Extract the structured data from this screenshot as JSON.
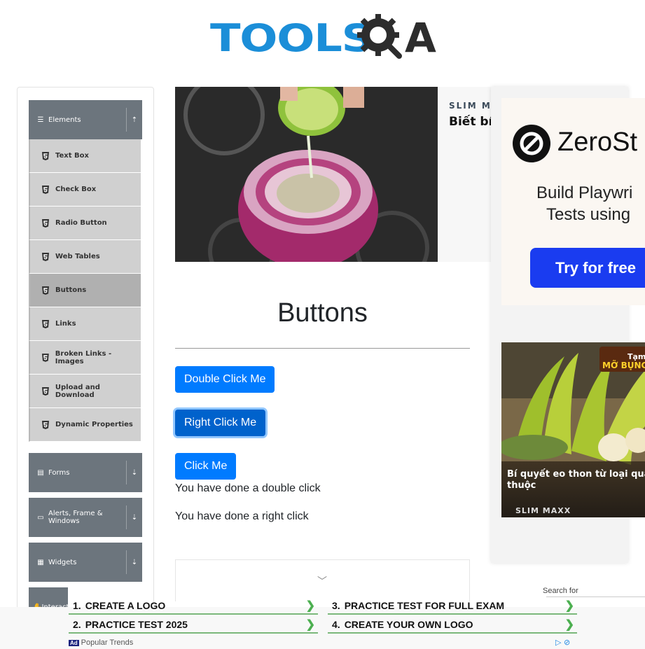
{
  "header": {
    "logo_text": "TOOLS",
    "logo_suffix": "A"
  },
  "sidebar": {
    "groups": [
      {
        "label": "Elements",
        "icon": "hamburger-icon",
        "expanded": true
      },
      {
        "label": "Forms",
        "icon": "document-icon",
        "expanded": false
      },
      {
        "label": "Alerts, Frame & Windows",
        "icon": "window-icon",
        "expanded": false
      },
      {
        "label": "Widgets",
        "icon": "grid-icon",
        "expanded": false
      },
      {
        "label": "Interact",
        "icon": "hand-icon",
        "expanded": false
      }
    ],
    "items": [
      {
        "label": "Text Box"
      },
      {
        "label": "Check Box"
      },
      {
        "label": "Radio Button"
      },
      {
        "label": "Web Tables"
      },
      {
        "label": "Buttons",
        "active": true
      },
      {
        "label": "Links"
      },
      {
        "label": "Broken Links - Images"
      },
      {
        "label": "Upload and Download"
      },
      {
        "label": "Dynamic Properties"
      }
    ]
  },
  "ad_top": {
    "brand": "SLIM MA",
    "headline": "Biết bí"
  },
  "main": {
    "title": "Buttons",
    "buttons": {
      "double": "Double Click Me",
      "right": "Right Click Me",
      "click": "Click Me"
    },
    "messages": {
      "double": "You have done a double click",
      "right": "You have done a right click"
    }
  },
  "ad_right": {
    "zero_name": "ZeroSt",
    "line1": "Build Playwri",
    "line2": "Tests using",
    "cta": "Try for free",
    "banana_tag1": "Tạm",
    "banana_tag2": "MỠ BỤNG,",
    "banana_caption": "Bí quyết eo thon từ loại quả q thuộc",
    "banana_brand": "SLIM MAXX"
  },
  "bottom_ad": {
    "search_for": "Search for",
    "links": [
      {
        "num": "1.",
        "text": "CREATE A LOGO"
      },
      {
        "num": "2.",
        "text": "PRACTICE TEST 2025"
      },
      {
        "num": "3.",
        "text": "PRACTICE TEST FOR FULL EXAM"
      },
      {
        "num": "4.",
        "text": "CREATE YOUR OWN LOGO"
      }
    ],
    "ad_label": "Ad",
    "popular": "Popular Trends"
  },
  "colors": {
    "primary": "#007bff",
    "sidebar_header": "#6c757d",
    "sidebar_item": "#d0d0d0",
    "logo_blue": "#1b8ed8",
    "ad_link_underline": "#7bb87b"
  }
}
